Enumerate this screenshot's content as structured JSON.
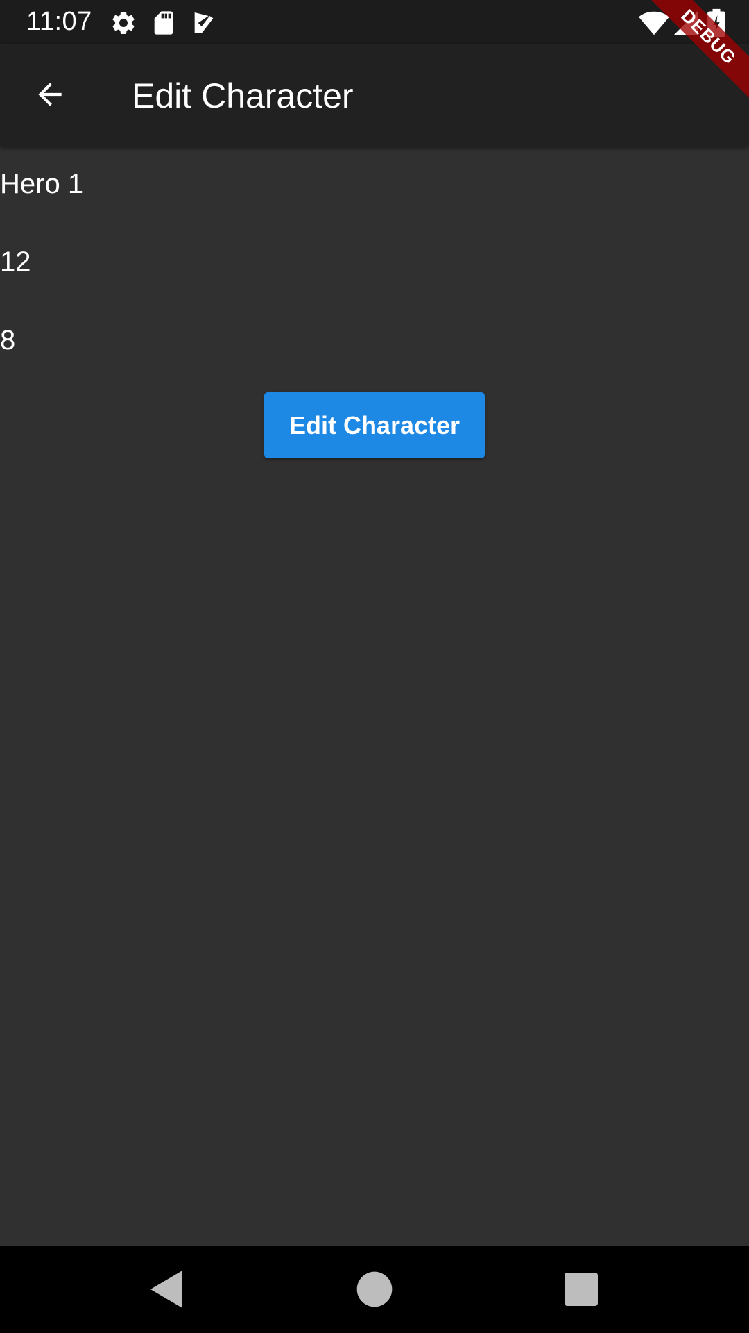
{
  "status_bar": {
    "time": "11:07",
    "icons": [
      "gear-icon",
      "sd-card-icon",
      "play-protect-icon",
      "wifi-icon",
      "cell-signal-icon",
      "battery-charging-icon"
    ]
  },
  "debug_banner": {
    "label": "DEBUG",
    "color": "#a00000"
  },
  "app_bar": {
    "back_icon": "arrow-back-icon",
    "title": "Edit Character"
  },
  "content": {
    "name": "Hero 1",
    "value_1": "12",
    "value_2": "8",
    "button_label": "Edit Character",
    "button_color": "#1e88e5"
  },
  "nav_bar": {
    "buttons": [
      "back-triangle-icon",
      "home-circle-icon",
      "recents-square-icon"
    ]
  }
}
